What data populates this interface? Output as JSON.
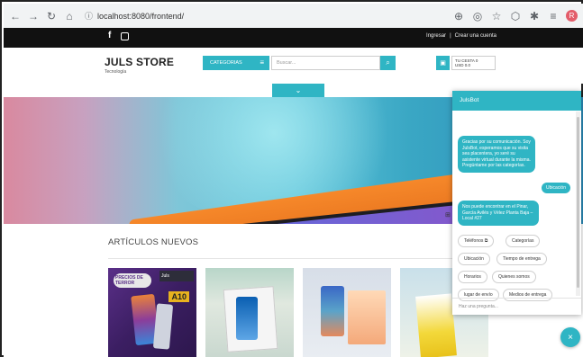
{
  "browser": {
    "url": "localhost:8080/frontend/",
    "profile_initial": "R"
  },
  "topbar": {
    "login": "Ingresar",
    "separator": "|",
    "register": "Crear una cuenta"
  },
  "header": {
    "store_name": "JULS STORE",
    "tagline": "Tecnología",
    "categories_label": "CATEGORIAS",
    "search_placeholder": "Buscar...",
    "cart_line1": "TU CESTA 0",
    "cart_line2": "USD 0.0"
  },
  "section": {
    "title": "ARTÍCULOS NUEVOS"
  },
  "products": [
    {
      "badge": "A10",
      "brand": "Juls",
      "promo": "PRECIOS DE TERROR"
    },
    {},
    {},
    {}
  ],
  "chatbot": {
    "title": "JulsBot",
    "greeting": "Gracias por su comunicación. Soy JulsBot, esperamos que su visita sea placentera, yo seré su asistente virtual durante la misma. Pregúntame por las categorías.",
    "user_message": "Ubicación",
    "location_reply": "Nos puede encontrar en el Pinar, García Avilés y Vélez Planta Baja – Local #27",
    "chips": [
      "Teléfonos",
      "Categorías",
      "Ubicación",
      "Tiempo de entrega",
      "Horarios",
      "Quienes somos",
      "lugar de envío",
      "Medios de entrega"
    ],
    "input_placeholder": "Haz una pregunta..."
  },
  "colors": {
    "accent": "#2fb5c4",
    "topbar": "#111111"
  }
}
